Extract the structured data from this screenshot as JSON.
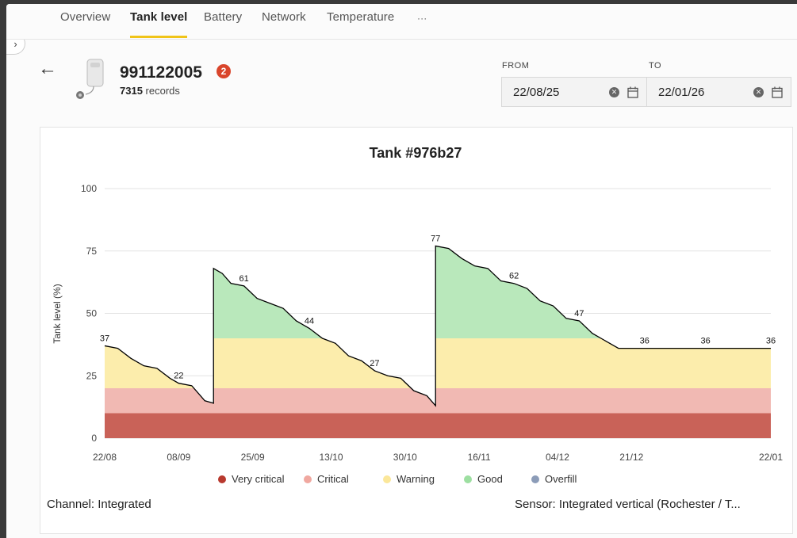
{
  "nav": {
    "collapse_icon": "chevron-right-icon",
    "tabs": [
      {
        "label": "Overview"
      },
      {
        "label": "Tank level",
        "active": true
      },
      {
        "label": "Battery"
      },
      {
        "label": "Network"
      },
      {
        "label": "Temperature"
      },
      {
        "label": "···"
      }
    ]
  },
  "device": {
    "id": "991122005",
    "alert_count": "2",
    "record_count": "7315",
    "records_label": "records"
  },
  "date_range": {
    "from_label": "FROM",
    "from_value": "22/08/25",
    "to_label": "TO",
    "to_value": "22/01/26"
  },
  "chart_data": {
    "type": "area",
    "title": "Tank #976b27",
    "ylabel": "Tank level (%)",
    "xlabel": "",
    "ylim": [
      0,
      100
    ],
    "xlim": [
      "2025-08-22",
      "2026-01-22"
    ],
    "y_ticks": [
      "0",
      "25",
      "50",
      "75",
      "100"
    ],
    "x_ticks": [
      {
        "label": "22/08",
        "date": "2025-08-22"
      },
      {
        "label": "08/09",
        "date": "2025-09-08"
      },
      {
        "label": "25/09",
        "date": "2025-09-25"
      },
      {
        "label": "13/10",
        "date": "2025-10-13"
      },
      {
        "label": "30/10",
        "date": "2025-10-30"
      },
      {
        "label": "16/11",
        "date": "2025-11-16"
      },
      {
        "label": "04/12",
        "date": "2025-12-04"
      },
      {
        "label": "21/12",
        "date": "2025-12-21"
      },
      {
        "label": "22/01",
        "date": "2026-01-22"
      }
    ],
    "grid": true,
    "legend_position": "bottom",
    "zones": [
      {
        "name": "Very critical",
        "min": 0,
        "max": 10,
        "color": "#c96258",
        "legend_color": "#b8392e"
      },
      {
        "name": "Critical",
        "min": 10,
        "max": 20,
        "color": "#f1b9b3",
        "legend_color": "#f0a8a0"
      },
      {
        "name": "Warning",
        "min": 20,
        "max": 40,
        "color": "#fcedac",
        "legend_color": "#fbe79a"
      },
      {
        "name": "Good",
        "min": 40,
        "max": 100,
        "color": "#b9e8bb",
        "legend_color": "#9ddfa1"
      },
      {
        "name": "Overfill",
        "legend_color": "#8c9cb8"
      }
    ],
    "series": [
      {
        "line_color": "#000000",
        "points": [
          {
            "date": "2025-08-22",
            "value": 37
          },
          {
            "date": "2025-08-25",
            "value": 36
          },
          {
            "date": "2025-08-28",
            "value": 32
          },
          {
            "date": "2025-08-31",
            "value": 29
          },
          {
            "date": "2025-09-03",
            "value": 28
          },
          {
            "date": "2025-09-06",
            "value": 24
          },
          {
            "date": "2025-09-08",
            "value": 22
          },
          {
            "date": "2025-09-11",
            "value": 21
          },
          {
            "date": "2025-09-14",
            "value": 15
          },
          {
            "date": "2025-09-16",
            "value": 14
          },
          {
            "date": "2025-09-16",
            "value": 68
          },
          {
            "date": "2025-09-18",
            "value": 66
          },
          {
            "date": "2025-09-20",
            "value": 62
          },
          {
            "date": "2025-09-23",
            "value": 61
          },
          {
            "date": "2025-09-26",
            "value": 56
          },
          {
            "date": "2025-09-29",
            "value": 54
          },
          {
            "date": "2025-10-02",
            "value": 52
          },
          {
            "date": "2025-10-05",
            "value": 47
          },
          {
            "date": "2025-10-08",
            "value": 44
          },
          {
            "date": "2025-10-11",
            "value": 40
          },
          {
            "date": "2025-10-14",
            "value": 38
          },
          {
            "date": "2025-10-17",
            "value": 33
          },
          {
            "date": "2025-10-20",
            "value": 31
          },
          {
            "date": "2025-10-23",
            "value": 27
          },
          {
            "date": "2025-10-26",
            "value": 25
          },
          {
            "date": "2025-10-29",
            "value": 24
          },
          {
            "date": "2025-11-01",
            "value": 19
          },
          {
            "date": "2025-11-04",
            "value": 17
          },
          {
            "date": "2025-11-06",
            "value": 13
          },
          {
            "date": "2025-11-06",
            "value": 77
          },
          {
            "date": "2025-11-09",
            "value": 76
          },
          {
            "date": "2025-11-12",
            "value": 72
          },
          {
            "date": "2025-11-15",
            "value": 69
          },
          {
            "date": "2025-11-18",
            "value": 68
          },
          {
            "date": "2025-11-21",
            "value": 63
          },
          {
            "date": "2025-11-24",
            "value": 62
          },
          {
            "date": "2025-11-27",
            "value": 60
          },
          {
            "date": "2025-11-30",
            "value": 55
          },
          {
            "date": "2025-12-03",
            "value": 53
          },
          {
            "date": "2025-12-06",
            "value": 48
          },
          {
            "date": "2025-12-09",
            "value": 47
          },
          {
            "date": "2025-12-12",
            "value": 42
          },
          {
            "date": "2025-12-15",
            "value": 39
          },
          {
            "date": "2025-12-18",
            "value": 36
          },
          {
            "date": "2025-12-24",
            "value": 36
          },
          {
            "date": "2026-01-07",
            "value": 36
          },
          {
            "date": "2026-01-22",
            "value": 36
          }
        ]
      }
    ],
    "annotations": [
      {
        "date": "2025-08-22",
        "value": 37,
        "text": "37"
      },
      {
        "date": "2025-09-08",
        "value": 22,
        "text": "22"
      },
      {
        "date": "2025-09-23",
        "value": 61,
        "text": "61"
      },
      {
        "date": "2025-10-08",
        "value": 44,
        "text": "44"
      },
      {
        "date": "2025-10-23",
        "value": 27,
        "text": "27"
      },
      {
        "date": "2025-11-06",
        "value": 77,
        "text": "77"
      },
      {
        "date": "2025-11-24",
        "value": 62,
        "text": "62"
      },
      {
        "date": "2025-12-09",
        "value": 47,
        "text": "47"
      },
      {
        "date": "2025-12-24",
        "value": 36,
        "text": "36"
      },
      {
        "date": "2026-01-07",
        "value": 36,
        "text": "36"
      },
      {
        "date": "2026-01-22",
        "value": 36,
        "text": "36"
      }
    ]
  },
  "footer": {
    "channel": "Channel: Integrated",
    "sensor": "Sensor: Integrated vertical (Rochester / T..."
  }
}
